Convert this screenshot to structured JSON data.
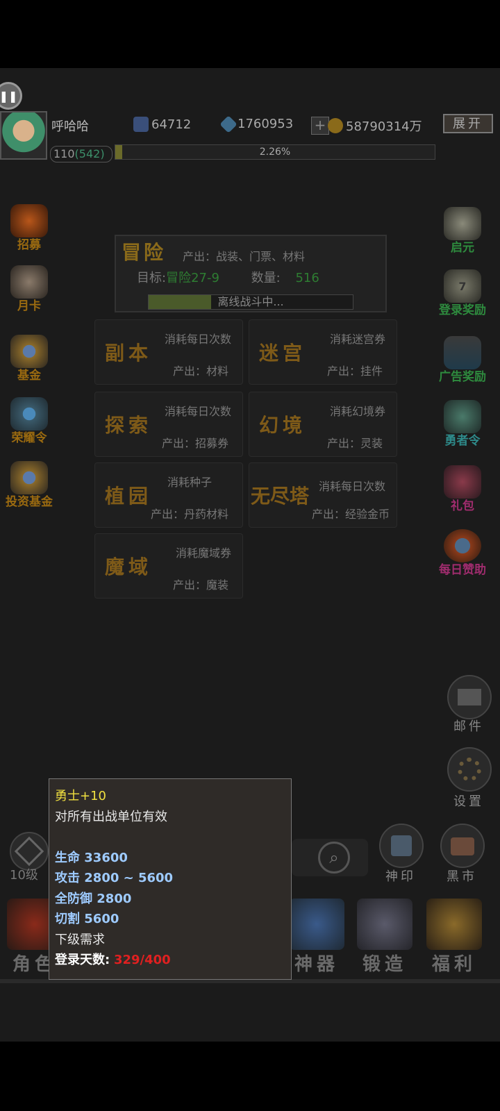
{
  "top": {
    "player_name": "呼哈哈",
    "currency1": "64712",
    "currency2": "1760953",
    "plus": "+",
    "gold": "58790314万",
    "expand": "展开",
    "level_main": "110",
    "level_sub": "(542)",
    "exp_percent_text": "2.26%",
    "exp_fraction": 0.0226
  },
  "left_buttons": [
    {
      "label": "招募",
      "color": "#9a6a10"
    },
    {
      "label": "月卡",
      "color": "#9a6a10"
    },
    {
      "label": "基金",
      "color": "#9a6a10"
    },
    {
      "label": "荣耀令",
      "color": "#9a6a10"
    },
    {
      "label": "投资基金",
      "color": "#9a6a10"
    }
  ],
  "right_buttons": [
    {
      "label": "启元",
      "color": "#2e8b3e"
    },
    {
      "label": "登录奖励",
      "color": "#2e8b3e"
    },
    {
      "label": "广告奖励",
      "color": "#2e8b3e"
    },
    {
      "label": "勇者令",
      "color": "#2e8b8b"
    },
    {
      "label": "礼包",
      "color": "#a02c6e"
    },
    {
      "label": "每日赞助",
      "color": "#a02c6e"
    }
  ],
  "badge_login_count": "7",
  "adventure": {
    "title": "冒险",
    "output": "产出：战装、门票、材料",
    "target_label": "目标:",
    "target_value": "冒险27-9",
    "count_label": "数量:",
    "count_value": "516",
    "status": "离线战斗中..."
  },
  "tiles": [
    {
      "name": "副本",
      "cost": "消耗每日次数",
      "out": "产出：材料"
    },
    {
      "name": "迷宫",
      "cost": "消耗迷宫券",
      "out": "产出：挂件"
    },
    {
      "name": "探索",
      "cost": "消耗每日次数",
      "out": "产出：招募券"
    },
    {
      "name": "幻境",
      "cost": "消耗幻境券",
      "out": "产出：灵装"
    },
    {
      "name": "植园",
      "cost": "消耗种子",
      "out": "产出：丹药材料"
    },
    {
      "name": "无尽塔",
      "cost": "消耗每日次数",
      "out": "产出：经验金币"
    },
    {
      "name": "魔域",
      "cost": "消耗魔域券",
      "out": "产出：魔装"
    }
  ],
  "mail_label": "邮件",
  "settings_label": "设置",
  "rank_label": "10级",
  "shenyin_label": "神印",
  "blackmarket_label": "黑市",
  "nav": {
    "role": "角色",
    "artifact": "神器",
    "forge": "锻造",
    "welfare": "福利"
  },
  "tooltip": {
    "title": "勇士+10",
    "desc": "对所有出战单位有效",
    "stat1": "生命  33600",
    "stat2": "攻击  2800 ~ 5600",
    "stat3": "全防御  2800",
    "stat4": "切割  5600",
    "req_title": "下级需求",
    "login_label": "登录天数:",
    "login_value": "329/400"
  }
}
